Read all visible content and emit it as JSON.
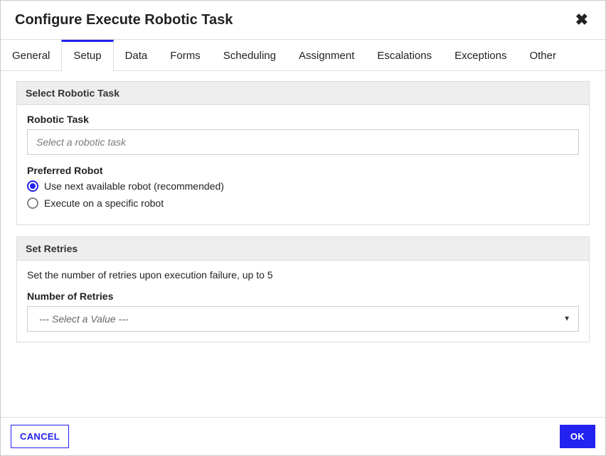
{
  "dialog": {
    "title": "Configure Execute Robotic Task"
  },
  "tabs": {
    "general": "General",
    "setup": "Setup",
    "data": "Data",
    "forms": "Forms",
    "scheduling": "Scheduling",
    "assignment": "Assignment",
    "escalations": "Escalations",
    "exceptions": "Exceptions",
    "other": "Other"
  },
  "panel1": {
    "header": "Select Robotic Task",
    "robotic_task_label": "Robotic Task",
    "robotic_task_placeholder": "Select a robotic task",
    "preferred_robot_label": "Preferred Robot",
    "radio1_label": "Use next available robot (recommended)",
    "radio2_label": "Execute on a specific robot"
  },
  "panel2": {
    "header": "Set Retries",
    "description": "Set the number of retries upon execution failure, up to 5",
    "num_retries_label": "Number of Retries",
    "num_retries_placeholder": "--- Select a Value ---"
  },
  "footer": {
    "cancel": "CANCEL",
    "ok": "OK"
  }
}
